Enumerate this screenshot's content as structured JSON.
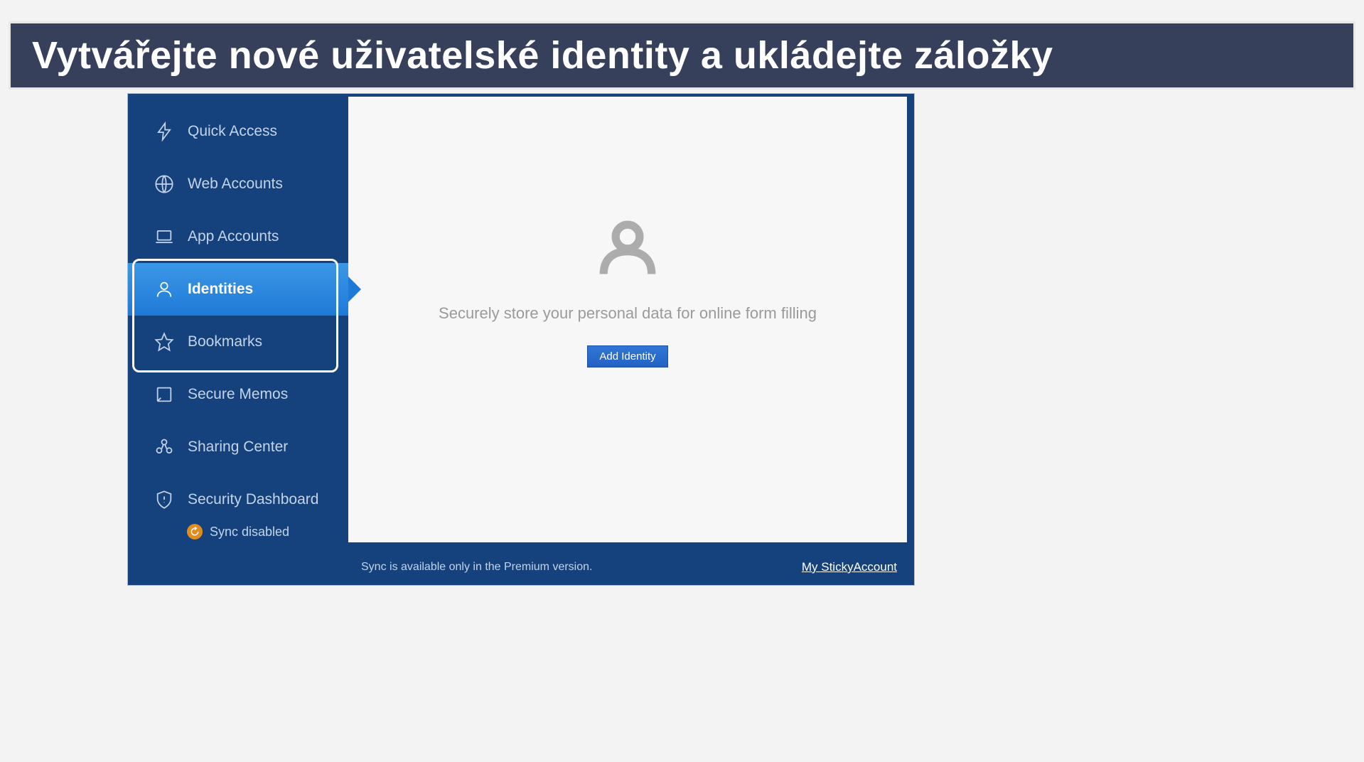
{
  "banner": {
    "text": "Vytvářejte nové uživatelské identity a ukládejte záložky"
  },
  "sidebar": {
    "items": [
      {
        "icon": "lightning-icon",
        "label": "Quick Access",
        "active": false
      },
      {
        "icon": "globe-icon",
        "label": "Web Accounts",
        "active": false
      },
      {
        "icon": "laptop-icon",
        "label": "App Accounts",
        "active": false
      },
      {
        "icon": "person-icon",
        "label": "Identities",
        "active": true
      },
      {
        "icon": "star-icon",
        "label": "Bookmarks",
        "active": false
      },
      {
        "icon": "memo-icon",
        "label": "Secure Memos",
        "active": false
      },
      {
        "icon": "sharing-icon",
        "label": "Sharing Center",
        "active": false
      },
      {
        "icon": "shield-icon",
        "label": "Security Dashboard",
        "active": false
      }
    ],
    "sync_status": "Sync disabled"
  },
  "main": {
    "empty_text": "Securely store your personal data for online form filling",
    "add_button": "Add Identity"
  },
  "footer": {
    "message": "Sync is available only in the Premium version.",
    "link": "My StickyAccount"
  }
}
